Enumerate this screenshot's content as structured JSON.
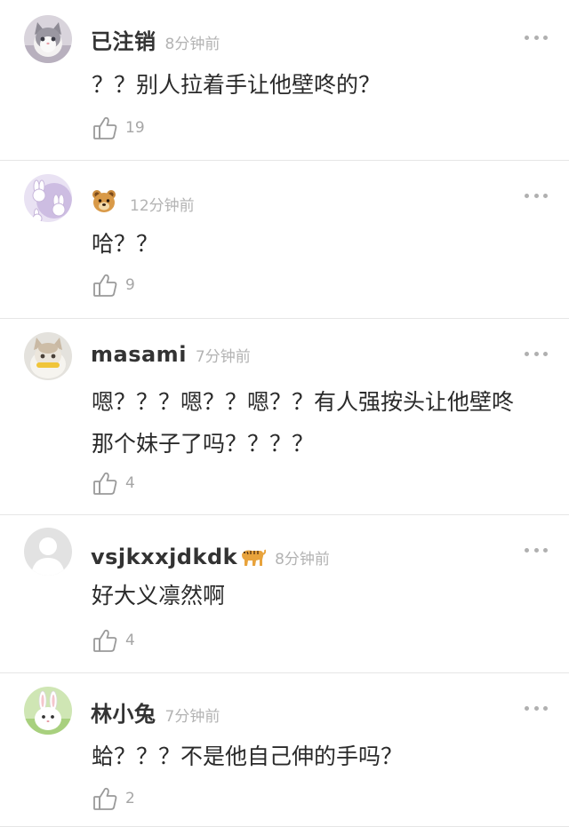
{
  "comments": [
    {
      "username": "已注销",
      "time": "8分钟前",
      "content": "？？别人拉着手让他壁咚的？",
      "likes": "19",
      "avatar": "cat-avatar"
    },
    {
      "username": "",
      "badge": "bear-face-emoji",
      "time": "12分钟前",
      "content": "哈？？",
      "likes": "9",
      "avatar": "bunny-pattern-avatar"
    },
    {
      "username": "masami",
      "time": "7分钟前",
      "content": "嗯？？？嗯？？嗯？？有人强按头让他壁咚那个妹子了吗？？？？",
      "likes": "4",
      "avatar": "kitten-avatar"
    },
    {
      "username": "vsjkxxjdkdk",
      "badge": "tiger-emoji",
      "time": "8分钟前",
      "content": "好大义凛然啊",
      "likes": "4",
      "avatar": "default-gray-avatar"
    },
    {
      "username": "林小兔",
      "time": "7分钟前",
      "content": "蛤？？？不是他自己伸的手吗？",
      "likes": "2",
      "avatar": "rabbit-avatar"
    }
  ]
}
